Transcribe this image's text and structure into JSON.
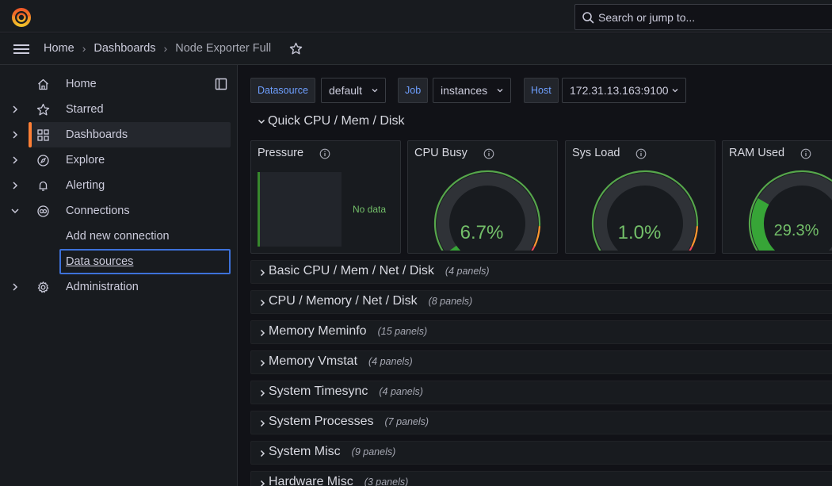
{
  "colors": {
    "accent_orange": "#ff7f35",
    "focus_blue": "#3d71d9",
    "green": "#73bf69",
    "label_blue": "#6e9fff"
  },
  "search": {
    "placeholder": "Search or jump to..."
  },
  "breadcrumb": [
    "Home",
    "Dashboards",
    "Node Exporter Full"
  ],
  "sidebar": {
    "items": [
      {
        "label": "Home",
        "icon": "home-icon",
        "expand": ""
      },
      {
        "label": "Starred",
        "icon": "star-icon",
        "expand": "collapsed"
      },
      {
        "label": "Dashboards",
        "icon": "apps-icon",
        "expand": "collapsed"
      },
      {
        "label": "Explore",
        "icon": "compass-icon",
        "expand": "collapsed"
      },
      {
        "label": "Alerting",
        "icon": "bell-icon",
        "expand": "collapsed"
      },
      {
        "label": "Connections",
        "icon": "connections-icon",
        "expand": "expanded"
      },
      {
        "label": "Administration",
        "icon": "gear-icon",
        "expand": "collapsed"
      }
    ],
    "sub_items": [
      "Add new connection",
      "Data sources"
    ]
  },
  "variables": [
    {
      "label": "Datasource",
      "value": "default"
    },
    {
      "label": "Job",
      "value": "instances"
    },
    {
      "label": "Host",
      "value": "172.31.13.163:9100"
    }
  ],
  "open_row": {
    "title": "Quick CPU / Mem / Disk"
  },
  "panels": [
    {
      "title": "Pressure",
      "no_data": "No data"
    },
    {
      "title": "CPU Busy",
      "value": "6.7%",
      "percent": 6.7
    },
    {
      "title": "Sys Load",
      "value": "1.0%",
      "percent": 1.0
    },
    {
      "title": "RAM Used",
      "value": "29.3%",
      "percent": 29.3
    }
  ],
  "rows": [
    {
      "title": "Basic CPU / Mem / Net / Disk",
      "count": "(4 panels)"
    },
    {
      "title": "CPU / Memory / Net / Disk",
      "count": "(8 panels)"
    },
    {
      "title": "Memory Meminfo",
      "count": "(15 panels)"
    },
    {
      "title": "Memory Vmstat",
      "count": "(4 panels)"
    },
    {
      "title": "System Timesync",
      "count": "(4 panels)"
    },
    {
      "title": "System Processes",
      "count": "(7 panels)"
    },
    {
      "title": "System Misc",
      "count": "(9 panels)"
    },
    {
      "title": "Hardware Misc",
      "count": "(3 panels)"
    }
  ]
}
